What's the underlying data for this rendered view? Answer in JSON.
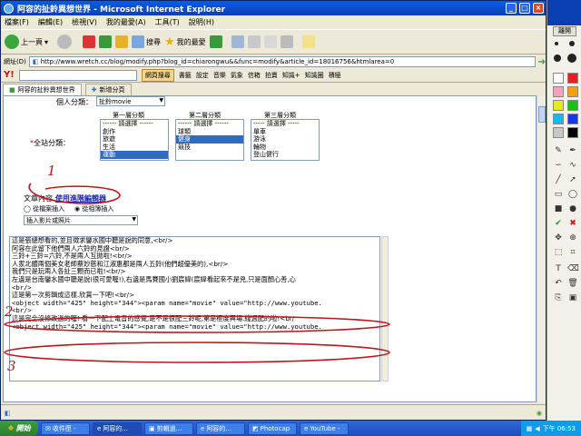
{
  "window": {
    "title": "阿容的扯鈴異想世界 - Microsoft Internet Explorer"
  },
  "menu": [
    "檔案(F)",
    "編輯(E)",
    "檢視(V)",
    "我的最愛(A)",
    "工具(T)",
    "說明(H)"
  ],
  "toolbar": {
    "back": "上一頁",
    "search": "搜尋",
    "favorites": "我的最愛"
  },
  "address": {
    "label": "網址(D)",
    "url": "http://www.wretch.cc/blog/modify.php?blog_id=chiarongwu&&func=modify&article_id=18016756&htmlarea=0"
  },
  "yahoo": {
    "logo": "Y!",
    "search_button": "網頁搜尋",
    "items": [
      "書籤",
      "設定",
      "音樂",
      "氣象",
      "信箱",
      "拍賣",
      "知識+",
      "知識圈",
      "積極"
    ]
  },
  "tabs": {
    "active": "阿容的扯鈴異想世界",
    "new_tab": "新增分頁"
  },
  "form": {
    "personal_category_label": "個人分類：",
    "personal_category_value": "扯鈴movie",
    "category_label": "全站分類：",
    "col_titles": [
      "第一層分類",
      "第二層分類",
      "第三層分類"
    ],
    "list1": [
      "------ 請選擇 ------",
      "創作",
      "旅遊",
      "生活",
      "運動"
    ],
    "list2": [
      "------ 請選擇 ------",
      "球類",
      "健身",
      "競技"
    ],
    "list3": [
      "----- 請選擇 -----",
      "單車",
      "游泳",
      "輪物",
      "登山健行"
    ],
    "content_label": "文章內容",
    "advanced_editor_link": "使用進階編輯器",
    "radio_file": "從檔案插入",
    "radio_web": "從相簿插入",
    "insert_select": "插入影片或照片"
  },
  "editor_lines": [
    "這是張總想看的,並且徵求鑾水國中聽是說的同意,<br/>",
    "阿容在此留下他們兩人六鈴的見證<br/>",
    "三鈴+三鈴=六鈴,不是兩人互拋啦!<br/>",
    "人家北體兩個美女老師蔡妙慈和江淑惠都是兩人五鈴(他們超優美的),<br/>",
    "我們只是玩兩人各扯三顆而已啦!<br/>",
    "左邊是台南鑾水國中聽是說(很可愛喔!),右邊是馬賽國小劉宸緯(宸緯看起來不是兇,只是面顏心善,心",
    "<br/>",
    "這是第一次剪輯成這樣.欣賞一下吧!<br/>",
    "<object width=\"425\" height=\"344\"><param name=\"movie\" value=\"http://www.youtube.",
    "<br/>",
    "這是完全沒修改過的喔! 看一下配上電音的感覺,是不是很配三鈴呢,第是極度興場.綫週配的啦!<br/",
    "<object width=\"425\" height=\"344\"><param name=\"movie\" value=\"http://www.youtube."
  ],
  "annotations": [
    "1",
    "2",
    "3"
  ],
  "pen_panel": {
    "close": "離開"
  },
  "taskbar": {
    "start": "開始",
    "tasks": [
      "收件匣 -",
      "阿容的...",
      "剪輯過...",
      "阿容的...",
      "Photocap",
      "YouTube -"
    ],
    "clock": "下午 06:53"
  }
}
